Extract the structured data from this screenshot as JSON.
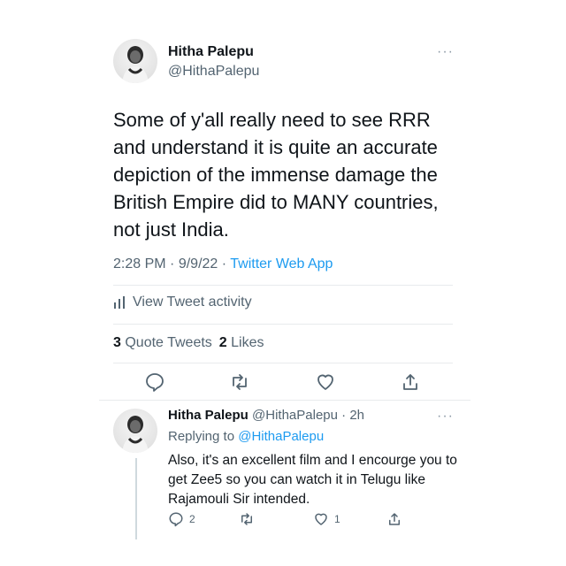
{
  "colors": {
    "accent": "#1d9bf0",
    "text": "#0f1419",
    "muted": "#536471"
  },
  "tweet": {
    "name": "Hitha Palepu",
    "handle": "@HithaPalepu",
    "more": "···",
    "text": "Some of y'all really need to see RRR and understand it is quite an accurate depiction of the immense damage the British Empire did to MANY countries, not just India.",
    "time": "2:28 PM",
    "date": "9/9/22",
    "source": "Twitter Web App",
    "activity_label": "View Tweet activity",
    "quote_count": "3",
    "quote_label": "Quote Tweets",
    "likes_count": "2",
    "likes_label": "Likes",
    "actions": [
      "reply-icon",
      "retweet-icon",
      "like-icon",
      "share-icon"
    ]
  },
  "reply": {
    "name": "Hitha Palepu",
    "handle": "@HithaPalepu",
    "age": "2h",
    "more": "···",
    "replying_label": "Replying to",
    "replying_to": "@HithaPalepu",
    "text": "Also, it's an excellent film and I encourge you to get Zee5 so you can watch it in Telugu like Rajamouli Sir intended.",
    "reply_count": "2",
    "like_count": "1"
  }
}
